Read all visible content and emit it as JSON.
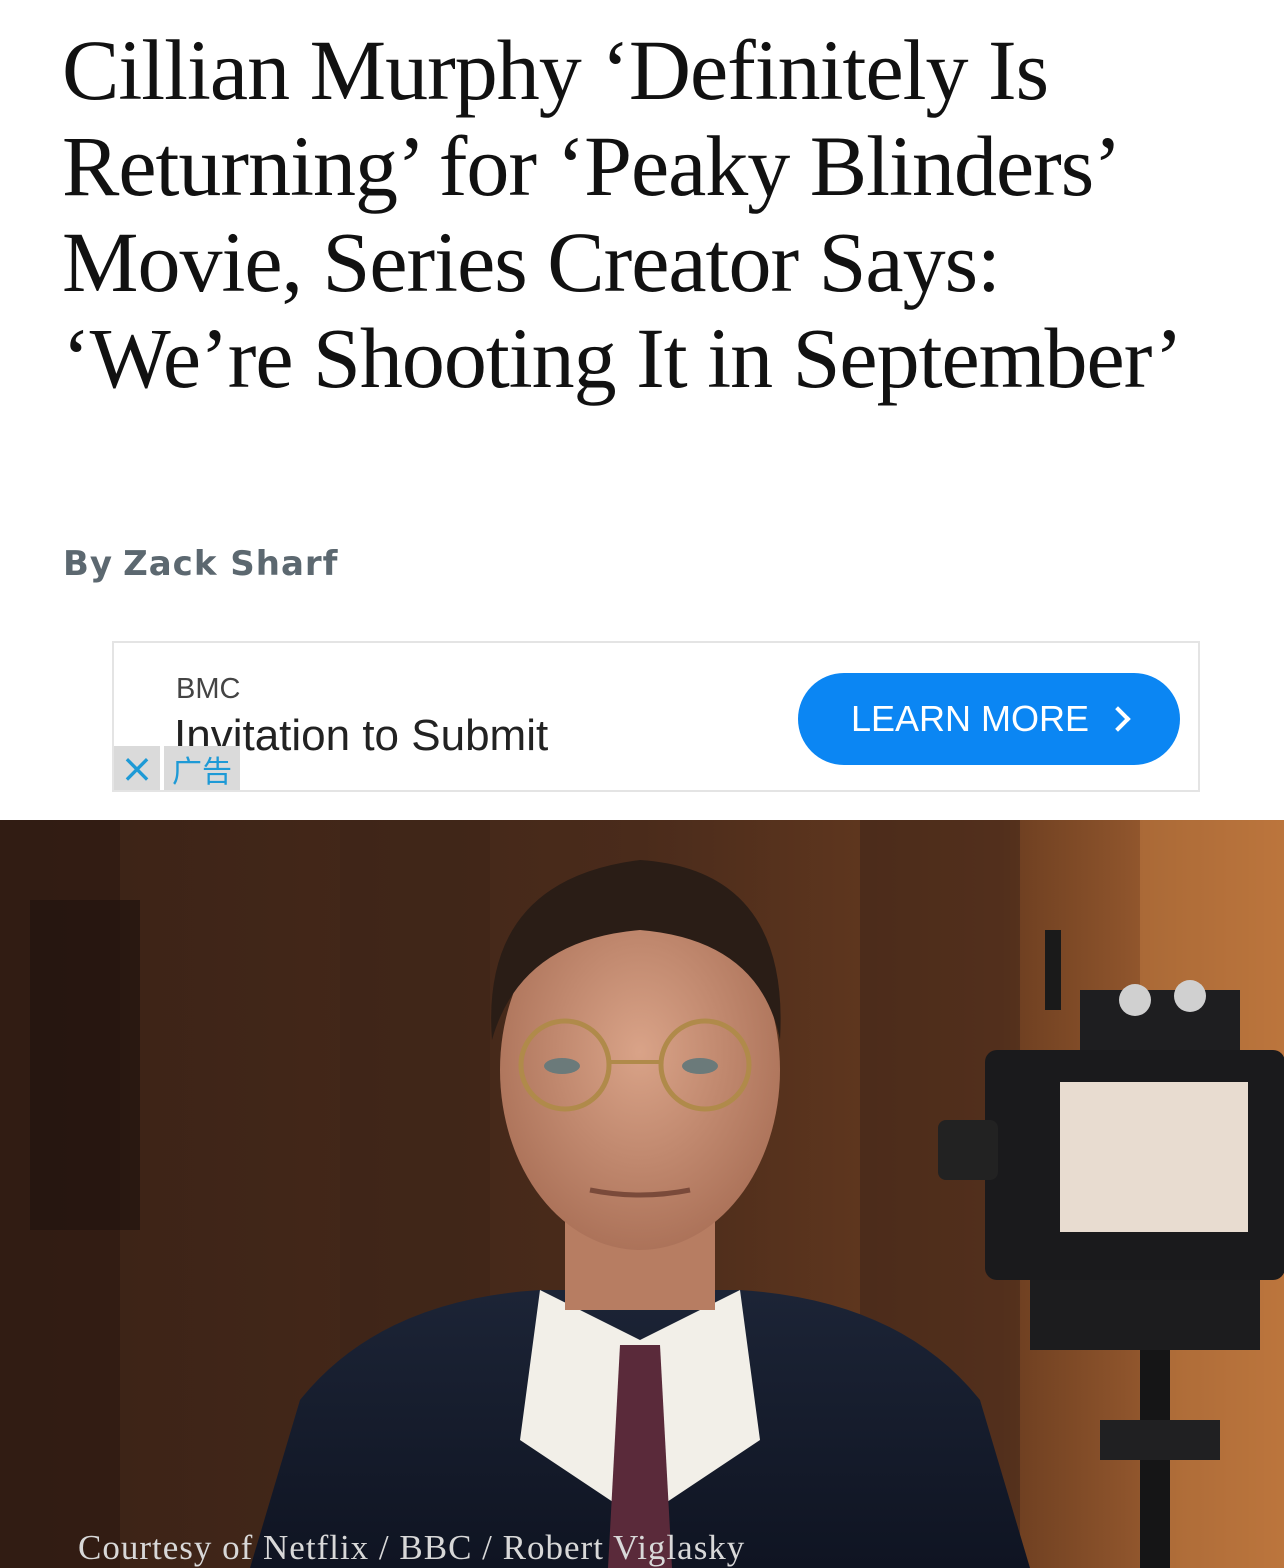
{
  "article": {
    "headline": "Cillian Murphy ‘Definitely Is Returning’ for ‘Peaky Blinders’ Movie, Series Creator Says: ‘We’re Shooting It in September’",
    "byline_prefix": "By",
    "author": "Zack Sharf"
  },
  "ad": {
    "brand": "BMC",
    "headline": "Invitation to Submit",
    "cta_label": "LEARN MORE",
    "cta_icon": "chevron-right-icon",
    "close_icon": "close-icon",
    "close_glyph": "×",
    "label": "广告",
    "colors": {
      "cta": "#0b86f3",
      "badge_text": "#1e9ad6"
    }
  },
  "image": {
    "description_icon": "photo",
    "credit": "Courtesy of Netflix / BBC / Robert Viglasky"
  }
}
